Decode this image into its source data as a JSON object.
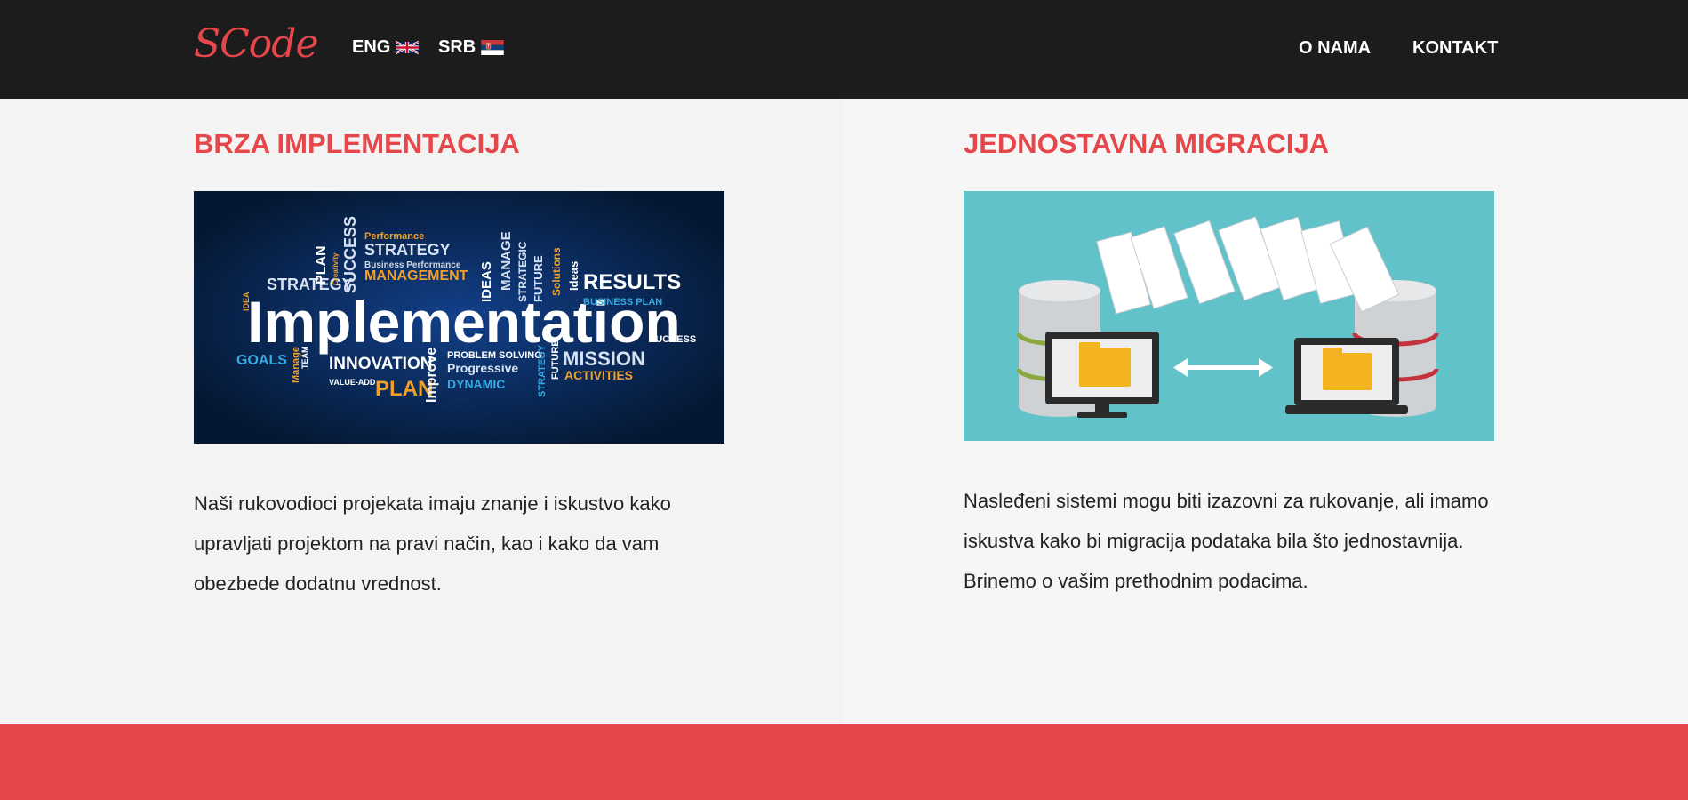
{
  "header": {
    "logo": "SCode",
    "languages": [
      {
        "label": "ENG",
        "flag": "uk-flag-icon"
      },
      {
        "label": "SRB",
        "flag": "serbia-flag-icon"
      }
    ],
    "nav": {
      "about": "O NAMA",
      "contact": "KONTAKT"
    }
  },
  "features": [
    {
      "title": "BRZA IMPLEMENTACIJA",
      "image": {
        "description_icon": "implementation-word-cloud-image",
        "headline": "Implementation",
        "words": [
          "PLAN",
          "SUCCESS",
          "Performance",
          "STRATEGY",
          "Business Performance",
          "MANAGEMENT",
          "IDEAS",
          "MANAGE",
          "STRATEGIC",
          "FUTURE",
          "Solutions",
          "Ideas",
          "RESULTS",
          "BUSINESS PLAN",
          "STRATEGY",
          "IDEA",
          "Creativity",
          "GOALS",
          "TEAM",
          "Manage",
          "INNOVATION",
          "VALUE-ADD",
          "PLAN",
          "Improve",
          "PROBLEM SOLVING",
          "Progressive",
          "DYNAMIC",
          "STRATEGY",
          "FUTURE",
          "MISSION",
          "ACTIVITIES",
          "SUCCESS"
        ]
      },
      "text": "Naši rukovodioci projekata imaju znanje i iskustvo kako upravljati projektom na pravi način, kao i kako da vam obezbede dodatnu vrednost."
    },
    {
      "title": "JEDNOSTAVNA MIGRACIJA",
      "image": {
        "description_icon": "data-migration-illustration"
      },
      "text": "Nasleđeni sistemi mogu biti izazovni za rukovanje, ali imamo iskustva kako bi migracija podataka bila što jednostavnija. Brinemo o vašim prethodnim podacima."
    }
  ],
  "colors": {
    "accent": "#e5474b",
    "header_bg": "#1c1c1c",
    "teal": "#62c2c9",
    "navy": "#0a2044"
  }
}
